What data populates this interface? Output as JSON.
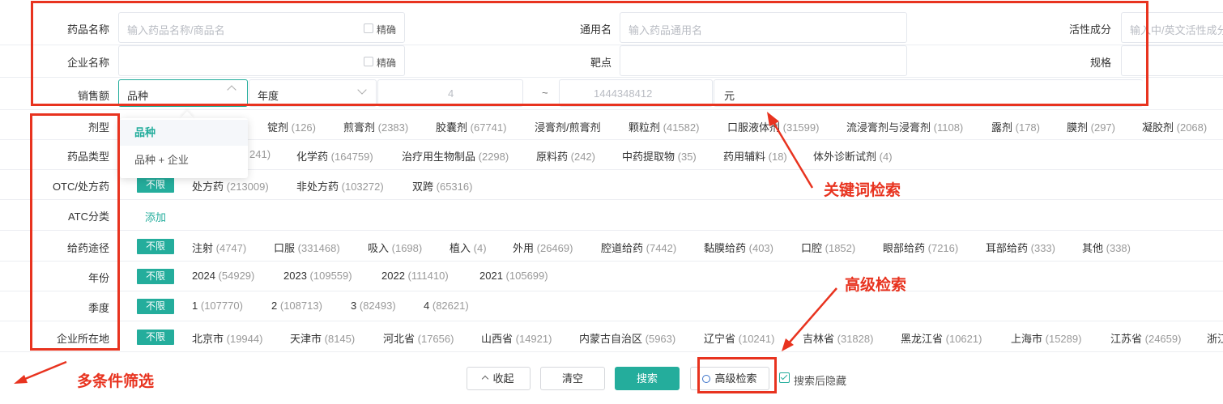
{
  "keyword": {
    "drug_name_label": "药品名称",
    "drug_name_placeholder": "输入药品名称/商品名",
    "exact_label": "精确",
    "generic_name_label": "通用名",
    "generic_name_placeholder": "输入药品通用名",
    "active_ingredient_label": "活性成分",
    "active_ingredient_placeholder": "输入中/英文活性成分",
    "company_name_label": "企业名称",
    "target_label": "靶点",
    "spec_label": "规格",
    "sales_label": "销售额",
    "sales_type_value": "品种",
    "sales_year_value": "年度",
    "sales_min": "4",
    "range_sep": "~",
    "sales_max": "1444348412",
    "unit": "元"
  },
  "dropdown": {
    "items": [
      "品种",
      "品种 + 企业"
    ]
  },
  "filters": {
    "all_label": "不限",
    "dosage_form": {
      "label": "剂型",
      "options": [
        {
          "name": "锭剂",
          "count": "(126)"
        },
        {
          "name": "煎膏剂",
          "count": "(2383)"
        },
        {
          "name": "胶囊剂",
          "count": "(67741)"
        },
        {
          "name": "浸膏剂/煎膏剂",
          "count": ""
        },
        {
          "name": "颗粒剂",
          "count": "(41582)"
        },
        {
          "name": "口服液体剂",
          "count": "(31599)"
        },
        {
          "name": "流浸膏剂与浸膏剂",
          "count": "(1108)"
        },
        {
          "name": "露剂",
          "count": "(178)"
        },
        {
          "name": "膜剂",
          "count": "(297)"
        },
        {
          "name": "凝胶剂",
          "count": "(2068)"
        }
      ]
    },
    "drug_type": {
      "label": "药品类型",
      "options": [
        {
          "name": "",
          "count": "241)"
        },
        {
          "name": "化学药",
          "count": "(164759)"
        },
        {
          "name": "治疗用生物制品",
          "count": "(2298)"
        },
        {
          "name": "原料药",
          "count": "(242)"
        },
        {
          "name": "中药提取物",
          "count": "(35)"
        },
        {
          "name": "药用辅料",
          "count": "(18)"
        },
        {
          "name": "体外诊断试剂",
          "count": "(4)"
        }
      ]
    },
    "otc": {
      "label": "OTC/处方药",
      "options": [
        {
          "name": "处方药",
          "count": "(213009)"
        },
        {
          "name": "非处方药",
          "count": "(103272)"
        },
        {
          "name": "双跨",
          "count": "(65316)"
        }
      ]
    },
    "atc": {
      "label": "ATC分类",
      "add_label": "添加"
    },
    "route": {
      "label": "给药途径",
      "options": [
        {
          "name": "注射",
          "count": "(4747)"
        },
        {
          "name": "口服",
          "count": "(331468)"
        },
        {
          "name": "吸入",
          "count": "(1698)"
        },
        {
          "name": "植入",
          "count": "(4)"
        },
        {
          "name": "外用",
          "count": "(26469)"
        },
        {
          "name": "腔道给药",
          "count": "(7442)"
        },
        {
          "name": "黏膜给药",
          "count": "(403)"
        },
        {
          "name": "口腔",
          "count": "(1852)"
        },
        {
          "name": "眼部给药",
          "count": "(7216)"
        },
        {
          "name": "耳部给药",
          "count": "(333)"
        },
        {
          "name": "其他",
          "count": "(338)"
        }
      ]
    },
    "year": {
      "label": "年份",
      "options": [
        {
          "name": "2024",
          "count": "(54929)"
        },
        {
          "name": "2023",
          "count": "(109559)"
        },
        {
          "name": "2022",
          "count": "(111410)"
        },
        {
          "name": "2021",
          "count": "(105699)"
        }
      ]
    },
    "quarter": {
      "label": "季度",
      "options": [
        {
          "name": "1",
          "count": "(107770)"
        },
        {
          "name": "2",
          "count": "(108713)"
        },
        {
          "name": "3",
          "count": "(82493)"
        },
        {
          "name": "4",
          "count": "(82621)"
        }
      ]
    },
    "location": {
      "label": "企业所在地",
      "options": [
        {
          "name": "北京市",
          "count": "(19944)"
        },
        {
          "name": "天津市",
          "count": "(8145)"
        },
        {
          "name": "河北省",
          "count": "(17656)"
        },
        {
          "name": "山西省",
          "count": "(14921)"
        },
        {
          "name": "内蒙古自治区",
          "count": "(5963)"
        },
        {
          "name": "辽宁省",
          "count": "(10241)"
        },
        {
          "name": "吉林省",
          "count": "(31828)"
        },
        {
          "name": "黑龙江省",
          "count": "(10621)"
        },
        {
          "name": "上海市",
          "count": "(15289)"
        },
        {
          "name": "江苏省",
          "count": "(24659)"
        },
        {
          "name": "浙江",
          "count": ""
        }
      ]
    }
  },
  "actions": {
    "collapse_label": "收起",
    "clear_label": "清空",
    "search_label": "搜索",
    "advanced_label": "高级检索",
    "hide_after_search_label": "搜索后隐藏"
  },
  "annotations": {
    "keyword_search": "关键词检索",
    "advanced_search": "高级检索",
    "multi_filter": "多条件筛选"
  },
  "colors": {
    "accent": "#24ad9c",
    "annotation": "#e8331f"
  }
}
